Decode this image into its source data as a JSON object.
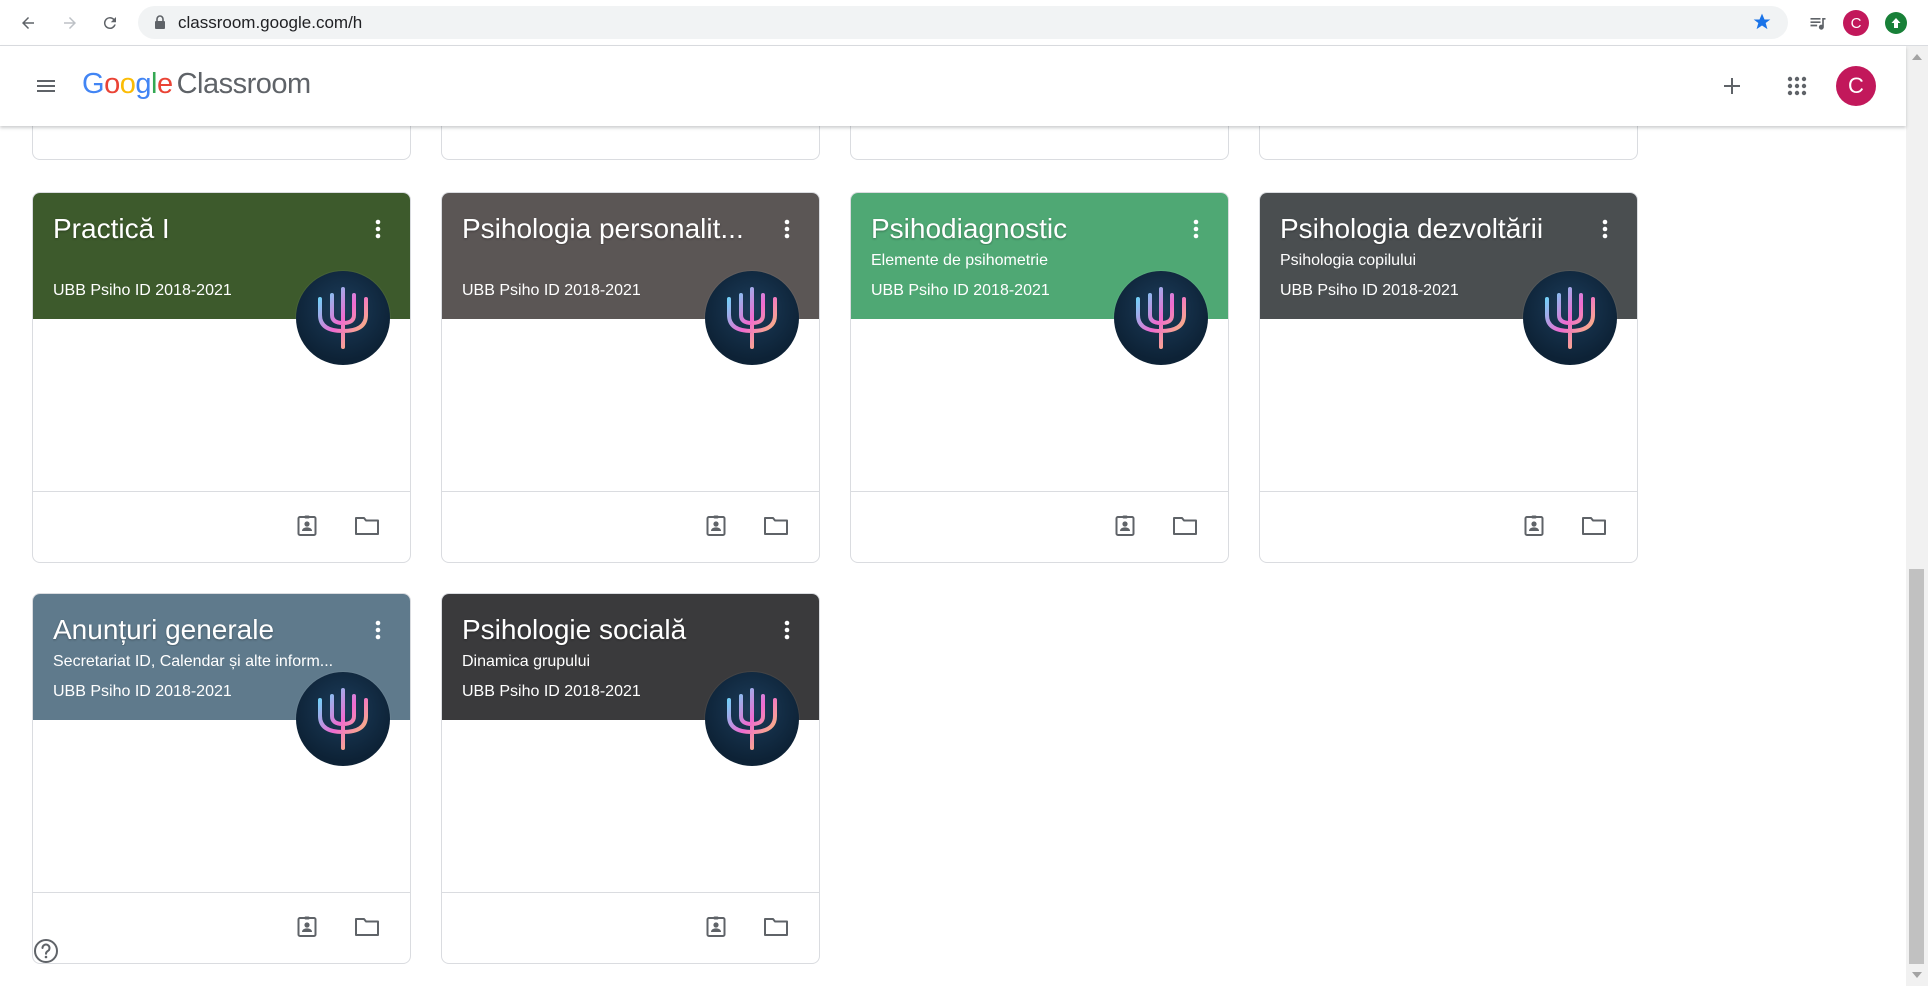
{
  "browser": {
    "url": "classroom.google.com/h",
    "profile_initial": "C"
  },
  "header": {
    "logo_google": [
      "G",
      "o",
      "o",
      "g",
      "l",
      "e"
    ],
    "product": "Classroom",
    "account_initial": "C"
  },
  "cards": [
    {
      "title": "Practică I",
      "subtitle": "",
      "owner": "UBB Psiho ID 2018-2021",
      "banner_color": "#3d5a2c"
    },
    {
      "title": "Psihologia personalit...",
      "subtitle": "",
      "owner": "UBB Psiho ID 2018-2021",
      "banner_color": "#5b5655"
    },
    {
      "title": "Psihodiagnostic",
      "subtitle": "Elemente de psihometrie",
      "owner": "UBB Psiho ID 2018-2021",
      "banner_color": "#4fa874"
    },
    {
      "title": "Psihologia dezvoltării",
      "subtitle": "Psihologia copilului",
      "owner": "UBB Psiho ID 2018-2021",
      "banner_color": "#4a4e50"
    },
    {
      "title": "Anunțuri generale",
      "subtitle": "Secretariat ID, Calendar și alte inform...",
      "owner": "UBB Psiho ID 2018-2021",
      "banner_color": "#5f7a8c"
    },
    {
      "title": "Psihologie socială",
      "subtitle": "Dinamica grupului",
      "owner": "UBB Psiho ID 2018-2021",
      "banner_color": "#3a3a3c"
    }
  ],
  "icons": {
    "card_menu": "more-vert-icon",
    "assignments": "assignment-ind-icon",
    "folder": "folder-icon",
    "avatar": "psi-icon",
    "help": "help-icon"
  },
  "colors": {
    "accent_blue": "#1a73e8",
    "account": "#c2185b",
    "divider": "#dadce0"
  }
}
